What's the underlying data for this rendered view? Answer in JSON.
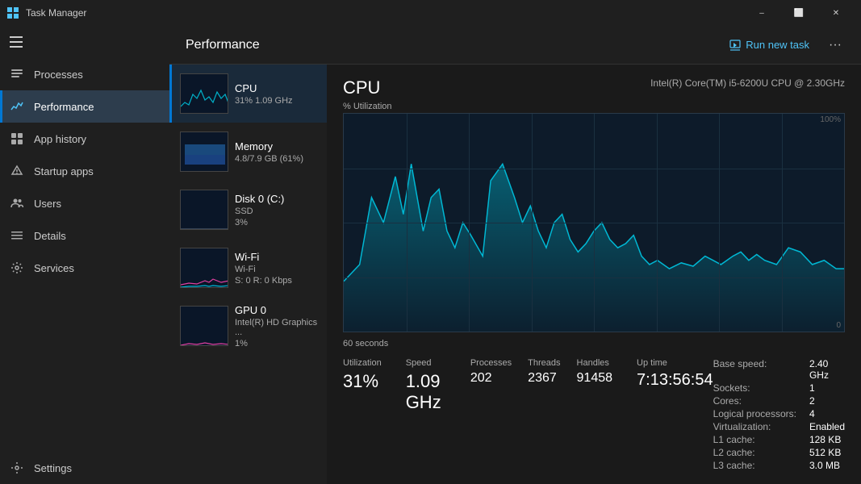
{
  "titlebar": {
    "title": "Task Manager",
    "minimize": "–",
    "maximize": "⬜",
    "close": "✕"
  },
  "sidebar": {
    "toggle_icon": "☰",
    "items": [
      {
        "id": "processes",
        "label": "Processes",
        "icon": "processes"
      },
      {
        "id": "performance",
        "label": "Performance",
        "icon": "performance",
        "active": true
      },
      {
        "id": "app-history",
        "label": "App history",
        "icon": "app-history"
      },
      {
        "id": "startup-apps",
        "label": "Startup apps",
        "icon": "startup"
      },
      {
        "id": "users",
        "label": "Users",
        "icon": "users"
      },
      {
        "id": "details",
        "label": "Details",
        "icon": "details"
      },
      {
        "id": "services",
        "label": "Services",
        "icon": "services"
      }
    ],
    "settings": {
      "label": "Settings",
      "icon": "settings"
    }
  },
  "header": {
    "title": "Performance",
    "run_new_task": "Run new task",
    "more_options": "···"
  },
  "devices": [
    {
      "id": "cpu",
      "name": "CPU",
      "sub1": "31% 1.09 GHz",
      "active": true
    },
    {
      "id": "memory",
      "name": "Memory",
      "sub1": "4.8/7.9 GB (61%)"
    },
    {
      "id": "disk",
      "name": "Disk 0 (C:)",
      "sub1": "SSD",
      "sub2": "3%"
    },
    {
      "id": "wifi",
      "name": "Wi-Fi",
      "sub1": "Wi-Fi",
      "sub2": "S: 0 R: 0 Kbps"
    },
    {
      "id": "gpu",
      "name": "GPU 0",
      "sub1": "Intel(R) HD Graphics ...",
      "sub2": "1%"
    }
  ],
  "cpu_detail": {
    "title": "CPU",
    "model": "Intel(R) Core(TM) i5-6200U CPU @ 2.30GHz",
    "utilization_label": "% Utilization",
    "graph_max": "100%",
    "graph_min": "0",
    "time_label": "60 seconds",
    "utilization_label2": "Utilization",
    "utilization_value": "31%",
    "speed_label": "Speed",
    "speed_value": "1.09 GHz",
    "processes_label": "Processes",
    "processes_value": "202",
    "threads_label": "Threads",
    "threads_value": "2367",
    "handles_label": "Handles",
    "handles_value": "91458",
    "uptime_label": "Up time",
    "uptime_value": "7:13:56:54",
    "base_speed_label": "Base speed:",
    "base_speed_value": "2.40 GHz",
    "sockets_label": "Sockets:",
    "sockets_value": "1",
    "cores_label": "Cores:",
    "cores_value": "2",
    "logical_proc_label": "Logical processors:",
    "logical_proc_value": "4",
    "virtualization_label": "Virtualization:",
    "virtualization_value": "Enabled",
    "l1_label": "L1 cache:",
    "l1_value": "128 KB",
    "l2_label": "L2 cache:",
    "l2_value": "512 KB",
    "l3_label": "L3 cache:",
    "l3_value": "3.0 MB"
  },
  "colors": {
    "accent": "#0078d4",
    "graph_line": "#00b0c8",
    "graph_fill": "rgba(0,176,200,0.3)",
    "active_sidebar": "#1a2a3a"
  }
}
